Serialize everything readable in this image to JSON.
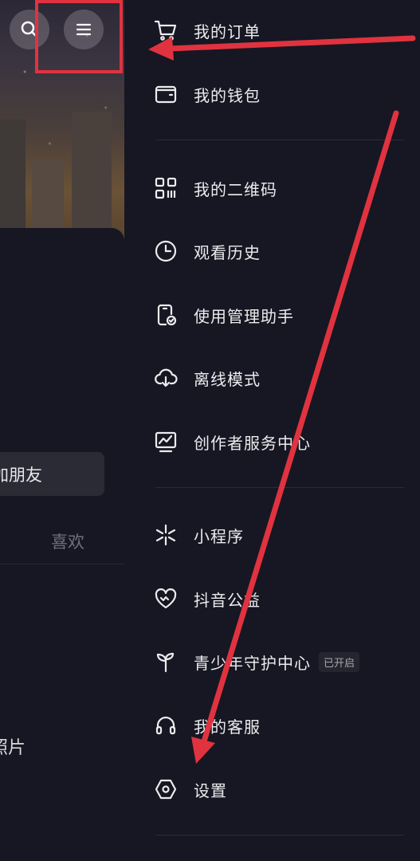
{
  "left_panel": {
    "friend_button_label": "加朋友",
    "likes_tab_label": "喜欢",
    "photos_label": "照片"
  },
  "drawer": {
    "items": [
      {
        "label": "我的订单",
        "icon": "cart-icon"
      },
      {
        "label": "我的钱包",
        "icon": "wallet-icon"
      },
      {
        "label": "我的二维码",
        "icon": "qrcode-icon"
      },
      {
        "label": "观看历史",
        "icon": "clock-icon"
      },
      {
        "label": "使用管理助手",
        "icon": "phone-check-icon"
      },
      {
        "label": "离线模式",
        "icon": "cloud-download-icon"
      },
      {
        "label": "创作者服务中心",
        "icon": "chart-monitor-icon"
      },
      {
        "label": "小程序",
        "icon": "asterisk-icon"
      },
      {
        "label": "抖音公益",
        "icon": "heart-icon"
      },
      {
        "label": "青少年守护中心",
        "icon": "sprout-icon",
        "badge": "已开启"
      },
      {
        "label": "我的客服",
        "icon": "headset-icon"
      },
      {
        "label": "设置",
        "icon": "hexagon-settings-icon"
      }
    ]
  },
  "colors": {
    "background": "#161722",
    "annotation_red": "#e0333f",
    "text": "#ececef"
  }
}
